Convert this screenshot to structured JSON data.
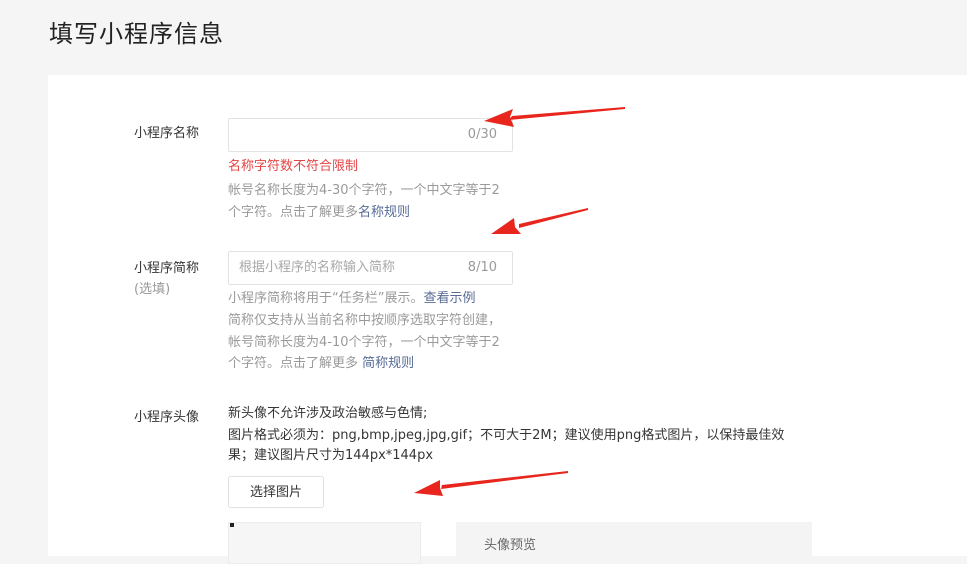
{
  "page": {
    "title": "填写小程序信息"
  },
  "name_field": {
    "label": "小程序名称",
    "value": "",
    "counter": "0/30",
    "error": "名称字符数不符合限制",
    "help_line1": "帐号名称长度为4-30个字符，一个中文字等于2",
    "help_line2_prefix": "个字符。点击了解更多",
    "help_link": "名称规则"
  },
  "short_name_field": {
    "label": "小程序简称",
    "sublabel": "(选填)",
    "placeholder": "根据小程序的名称输入简称",
    "counter": "8/10",
    "help_line1_prefix": "小程序简称将用于“任务栏”展示。",
    "help_line1_link": "查看示例",
    "help_line2": "简称仅支持从当前名称中按顺序选取字符创建，",
    "help_line3": "帐号简称长度为4-10个字符，一个中文字等于2",
    "help_line4_prefix": "个字符。点击了解更多 ",
    "help_link": "简称规则"
  },
  "avatar_field": {
    "label": "小程序头像",
    "desc_line1": "新头像不允许涉及政治敏感与色情;",
    "desc_line2": "图片格式必须为：png,bmp,jpeg,jpg,gif；不可大于2M；建议使用png格式图片，以保持最佳效",
    "desc_line3": "果；建议图片尺寸为144px*144px",
    "select_button": "选择图片",
    "preview_label": "头像预览"
  },
  "colors": {
    "arrow": "#e8261e",
    "error": "#e54545",
    "link": "#576b95"
  }
}
